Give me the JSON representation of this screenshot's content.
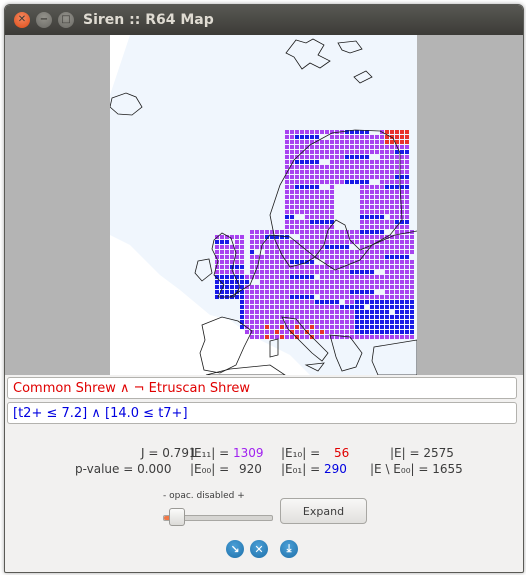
{
  "window": {
    "title": "Siren :: R64 Map"
  },
  "map": {
    "colors": {
      "both": "#a843f0",
      "only_left": "#e8322b",
      "only_right": "#1a1ae6",
      "coast": "#1a1a1a",
      "sea": "#f0f6fd"
    }
  },
  "query": {
    "left": "Common Shrew ∧ ¬ Etruscan Shrew",
    "right": "[t2+ ≤ 7.2] ∧ [14.0 ≤ t7+]"
  },
  "stats": {
    "j_label": "J = ",
    "j_value": "0.791",
    "p_label": "p-value = ",
    "p_value": "0.000",
    "e11_label": "|E₁₁| = ",
    "e11_value": "1309",
    "e10_label": "|E₁₀| = ",
    "e10_value": "56",
    "e_label": "|E| = ",
    "e_value": "2575",
    "e00_label": "|E₀₀| = ",
    "e00_value": "920",
    "e01_label": "|E₀₁| = ",
    "e01_value": "290",
    "eminus_label": "|E \\ E₀₀| = ",
    "eminus_value": "1655",
    "colors": {
      "e11": "#a020f0",
      "e10": "#e00000",
      "e01": "#0000e0"
    }
  },
  "controls": {
    "slider_caption": "- opac. disabled +",
    "slider_level": 0.08,
    "expand_label": "Expand"
  },
  "icons": [
    "close-icon",
    "minimize-icon",
    "maximize-icon",
    "arrow-down-right-icon",
    "cancel-icon",
    "download-icon"
  ]
}
